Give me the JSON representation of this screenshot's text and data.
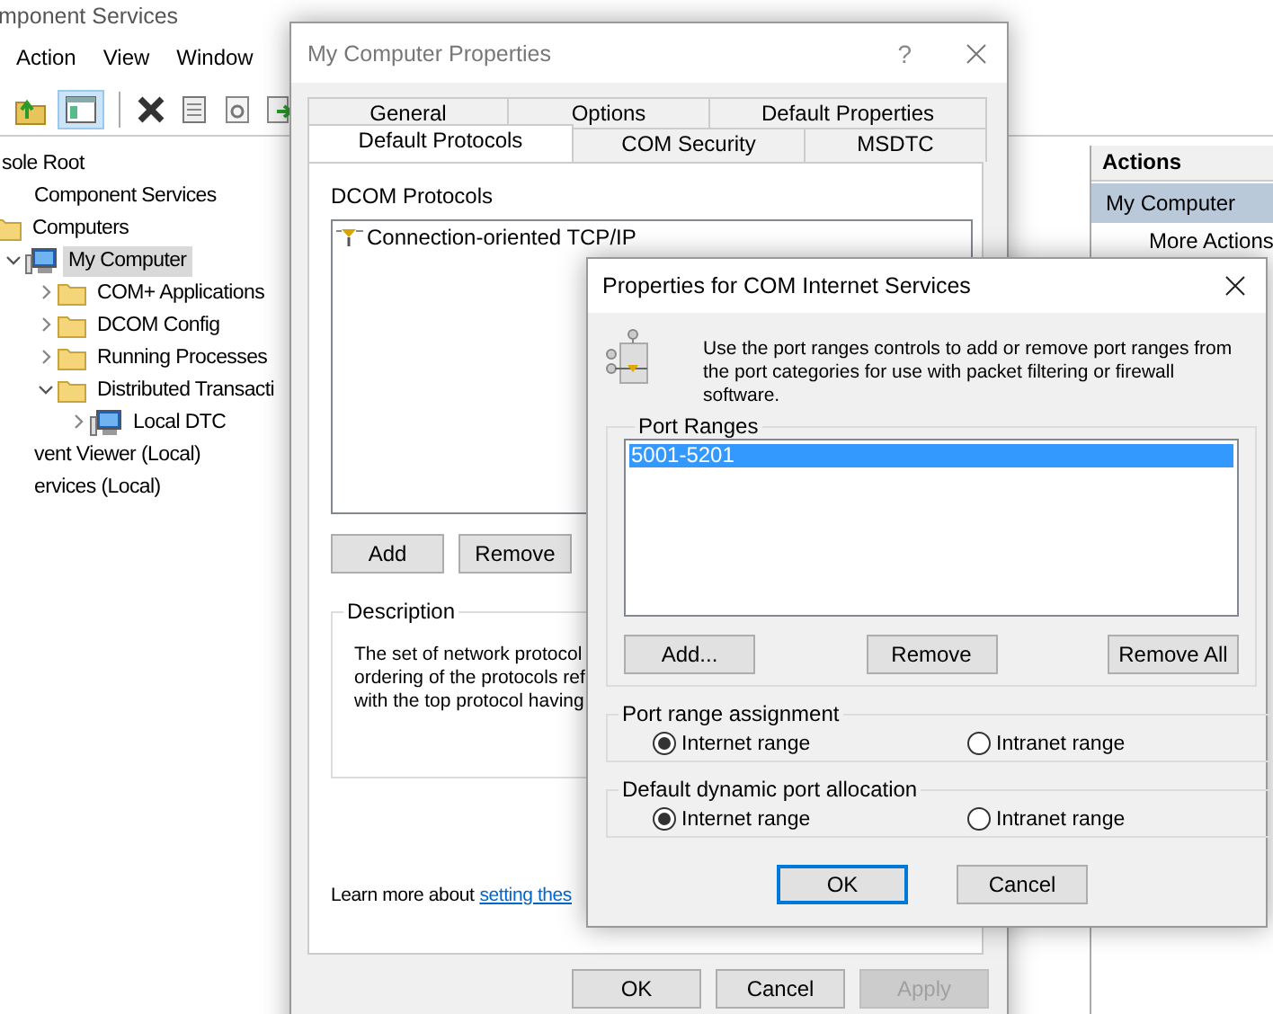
{
  "console": {
    "title": "mponent Services",
    "menu": [
      "Action",
      "View",
      "Window"
    ],
    "tree": [
      {
        "label": "sole Root",
        "kind": "root",
        "selected": false,
        "children": [
          {
            "label": "Component Services",
            "kind": "root",
            "selected": false,
            "children": [
              {
                "label": "Computers",
                "kind": "folder",
                "selected": false,
                "children": [
                  {
                    "label": "My Computer",
                    "kind": "computer",
                    "selected": true,
                    "expanded": true,
                    "children": [
                      {
                        "label": "COM+ Applications",
                        "kind": "folder",
                        "selected": false,
                        "expanded": false
                      },
                      {
                        "label": "DCOM Config",
                        "kind": "folder",
                        "selected": false,
                        "expanded": false
                      },
                      {
                        "label": "Running Processes",
                        "kind": "folder",
                        "selected": false,
                        "expanded": false
                      },
                      {
                        "label": "Distributed Transacti",
                        "kind": "folder",
                        "selected": false,
                        "expanded": true,
                        "children": [
                          {
                            "label": "Local DTC",
                            "kind": "computer",
                            "selected": false,
                            "expanded": false
                          }
                        ]
                      }
                    ]
                  }
                ]
              }
            ]
          },
          {
            "label": "vent Viewer (Local)",
            "kind": "root",
            "selected": false
          },
          {
            "label": "ervices (Local)",
            "kind": "root",
            "selected": false
          }
        ]
      }
    ],
    "actions": {
      "header": "Actions",
      "items": [
        {
          "label": "My Computer",
          "selected": true
        },
        {
          "label": "More Actions",
          "selected": false
        }
      ]
    }
  },
  "properties_dialog": {
    "title": "My Computer Properties",
    "help": "?",
    "tab_rows": [
      {
        "tabs": [
          {
            "label": "General",
            "selected": false
          },
          {
            "label": "Options",
            "selected": false
          },
          {
            "label": "Default Properties",
            "selected": false
          }
        ]
      },
      {
        "tabs": [
          {
            "label": "Default Protocols",
            "selected": true
          },
          {
            "label": "COM Security",
            "selected": false
          },
          {
            "label": "MSDTC",
            "selected": false
          }
        ]
      }
    ],
    "protocols_label": "DCOM Protocols",
    "protocols": [
      {
        "label": "Connection-oriented TCP/IP",
        "selected": false
      }
    ],
    "list_buttons": [
      "Add",
      "Remove"
    ],
    "description": {
      "label": "Description",
      "lines": [
        "The set of network protocol",
        "ordering of the protocols ref",
        "with the top protocol having"
      ]
    },
    "learn_more": {
      "text": "Learn more about",
      "link": "setting thes"
    },
    "buttons": [
      {
        "label": "OK",
        "disabled": false
      },
      {
        "label": "Cancel",
        "disabled": false
      },
      {
        "label": "Apply",
        "disabled": true
      }
    ]
  },
  "com_dialog": {
    "title": "Properties for COM Internet Services",
    "intro": "Use the port ranges controls to add or remove port ranges from the port categories for use with packet filtering or firewall software.",
    "port_ranges": {
      "label": "Port Ranges",
      "items": [
        {
          "label": "5001-5201",
          "selected": true
        }
      ],
      "buttons": [
        "Add...",
        "Remove",
        "Remove All"
      ]
    },
    "groups": [
      {
        "label": "Port range assignment",
        "options": [
          {
            "label": "Internet range",
            "selected": true
          },
          {
            "label": "Intranet range",
            "selected": false
          }
        ]
      },
      {
        "label": "Default dynamic port allocation",
        "options": [
          {
            "label": "Internet range",
            "selected": true
          },
          {
            "label": "Intranet range",
            "selected": false
          }
        ]
      }
    ],
    "buttons": [
      {
        "label": "OK",
        "default": true
      },
      {
        "label": "Cancel",
        "default": false
      }
    ]
  }
}
